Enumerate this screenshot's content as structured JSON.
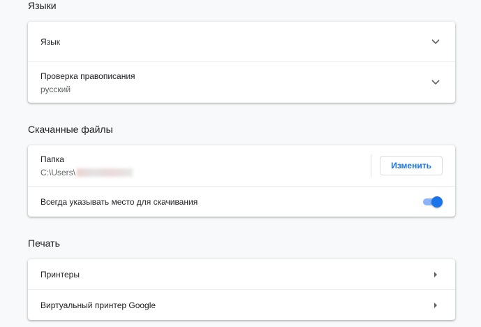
{
  "languages": {
    "title": "Языки",
    "rows": [
      {
        "label": "Язык"
      },
      {
        "label": "Проверка правописания",
        "sub": "русский"
      }
    ]
  },
  "downloads": {
    "title": "Скачанные файлы",
    "folder": {
      "label": "Папка",
      "path": "C:\\Users\\",
      "button": "Изменить"
    },
    "ask": {
      "label": "Всегда указывать место для скачивания",
      "enabled": true
    }
  },
  "printing": {
    "title": "Печать",
    "rows": [
      {
        "label": "Принтеры"
      },
      {
        "label": "Виртуальный принтер Google"
      }
    ]
  },
  "colors": {
    "accent": "#1a73e8",
    "toggle_track": "#8ab4f8",
    "background": "#f8f9fa"
  },
  "icons": {
    "expand": "chevron-down-icon",
    "open": "arrow-right-icon"
  }
}
